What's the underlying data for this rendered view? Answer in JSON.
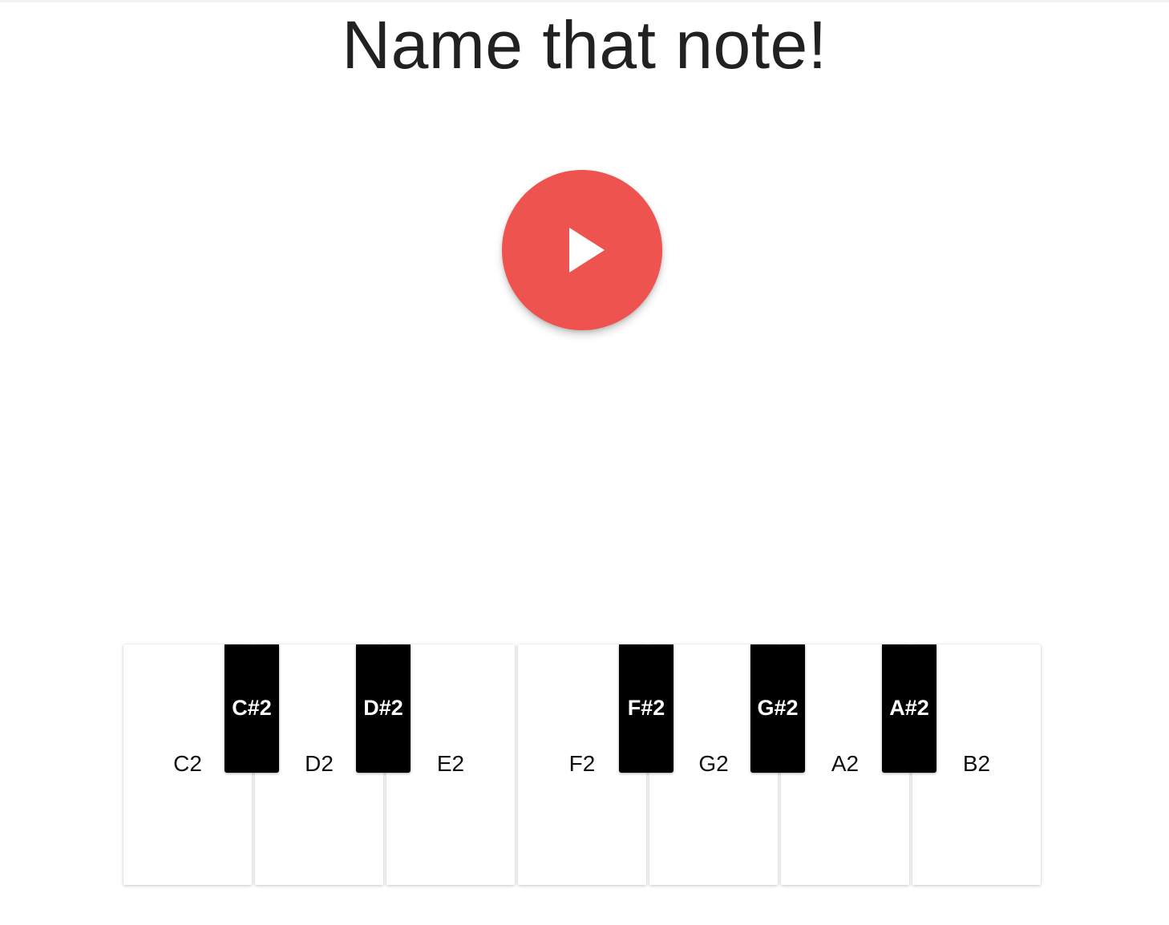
{
  "page": {
    "title": "Name that note!"
  },
  "play_button": {
    "icon": "play-icon",
    "color": "#ef5350"
  },
  "keyboard": {
    "white_keys": [
      {
        "label": "C2"
      },
      {
        "label": "D2"
      },
      {
        "label": "E2"
      },
      {
        "label": "F2"
      },
      {
        "label": "G2"
      },
      {
        "label": "A2"
      },
      {
        "label": "B2"
      }
    ],
    "black_keys": [
      {
        "label": "C#2"
      },
      {
        "label": "D#2"
      },
      {
        "label": "F#2"
      },
      {
        "label": "G#2"
      },
      {
        "label": "A#2"
      }
    ]
  }
}
